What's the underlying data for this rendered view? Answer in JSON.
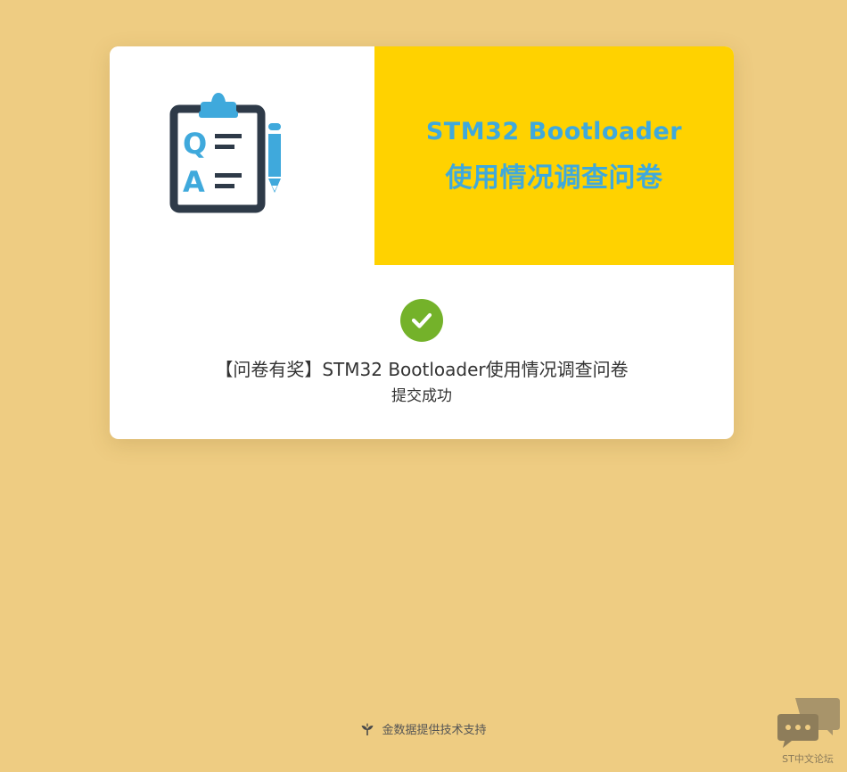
{
  "banner": {
    "title_line1": "STM32 Bootloader",
    "title_line2": "使用情况调查问卷",
    "icon": "qa-clipboard-icon"
  },
  "result": {
    "icon": "check-circle-icon",
    "survey_title": "【问卷有奖】STM32 Bootloader使用情况调查问卷",
    "status": "提交成功"
  },
  "footer": {
    "icon": "sprout-icon",
    "text": "金数据提供技术支持"
  },
  "forum_widget": {
    "icon": "chat-bubbles-icon",
    "label": "ST中文论坛"
  },
  "colors": {
    "background": "#EECC82",
    "banner_yellow": "#FFD200",
    "banner_text": "#3FA9DC",
    "check_green": "#74B22A"
  }
}
